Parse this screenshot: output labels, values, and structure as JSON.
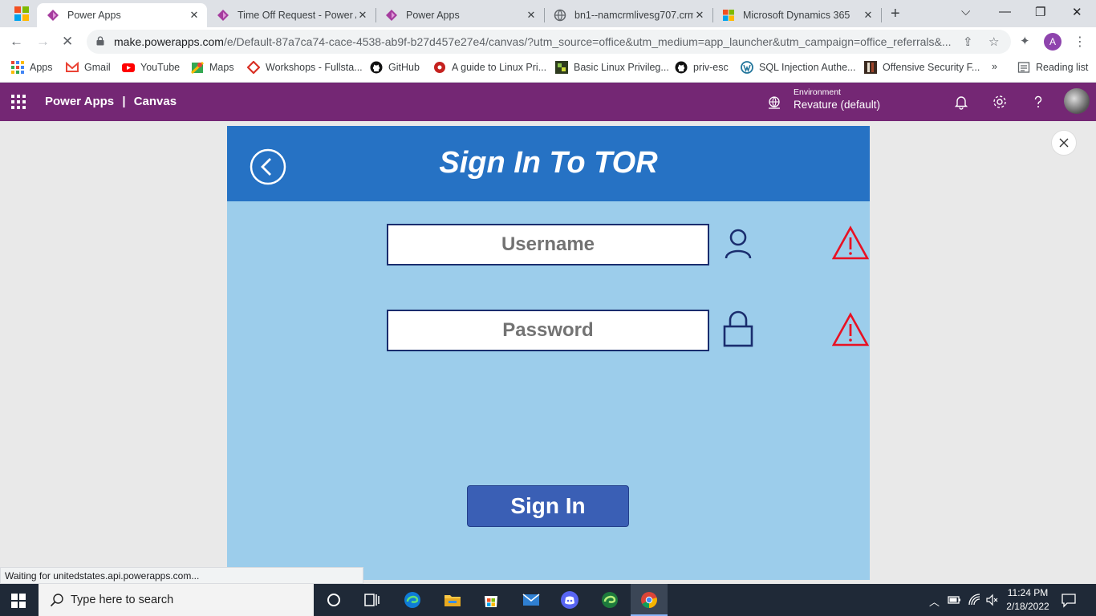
{
  "browser": {
    "tabs": [
      {
        "title": "Power Apps",
        "active": true
      },
      {
        "title": "Time Off Request - Power A",
        "active": false
      },
      {
        "title": "Power Apps",
        "active": false
      },
      {
        "title": "bn1--namcrmlivesg707.crm",
        "active": false
      },
      {
        "title": "Microsoft Dynamics 365",
        "active": false
      }
    ],
    "url_host": "make.powerapps.com",
    "url_rest": "/e/Default-87a7ca74-cace-4538-ab9f-b27d457e27e4/canvas/?utm_source=office&utm_medium=app_launcher&utm_campaign=office_referrals&...",
    "profile_initial": "A",
    "bookmarks": [
      {
        "label": "Apps",
        "icon": "apps-grid-icon"
      },
      {
        "label": "Gmail",
        "icon": "gmail-icon"
      },
      {
        "label": "YouTube",
        "icon": "youtube-icon"
      },
      {
        "label": "Maps",
        "icon": "maps-icon"
      },
      {
        "label": "Workshops - Fullsta...",
        "icon": "workshops-icon"
      },
      {
        "label": "GitHub",
        "icon": "github-icon"
      },
      {
        "label": "A guide to Linux Pri...",
        "icon": "guide-icon"
      },
      {
        "label": "Basic Linux Privileg...",
        "icon": "basic-linux-icon"
      },
      {
        "label": "priv-esc",
        "icon": "github-icon"
      },
      {
        "label": "SQL Injection Authe...",
        "icon": "wordpress-icon"
      },
      {
        "label": "Offensive Security F...",
        "icon": "offsec-icon"
      }
    ],
    "bookmarks_overflow": "»",
    "reading_list": "Reading list",
    "status_text": "Waiting for unitedstates.api.powerapps.com..."
  },
  "powerapps": {
    "product": "Power Apps",
    "separator": "|",
    "mode": "Canvas",
    "env_label": "Environment",
    "env_value": "Revature (default)"
  },
  "app": {
    "title": "Sign In To TOR",
    "username_placeholder": "Username",
    "password_placeholder": "Password",
    "signin_label": "Sign In"
  },
  "taskbar": {
    "search_placeholder": "Type here to search",
    "time": "11:24 PM",
    "date": "2/18/2022"
  },
  "colors": {
    "header_purple": "#742774",
    "app_header_blue": "#2672c4",
    "app_bg": "#9ccdeb",
    "button_blue": "#3a5fb5",
    "warning_red": "#e81123"
  }
}
